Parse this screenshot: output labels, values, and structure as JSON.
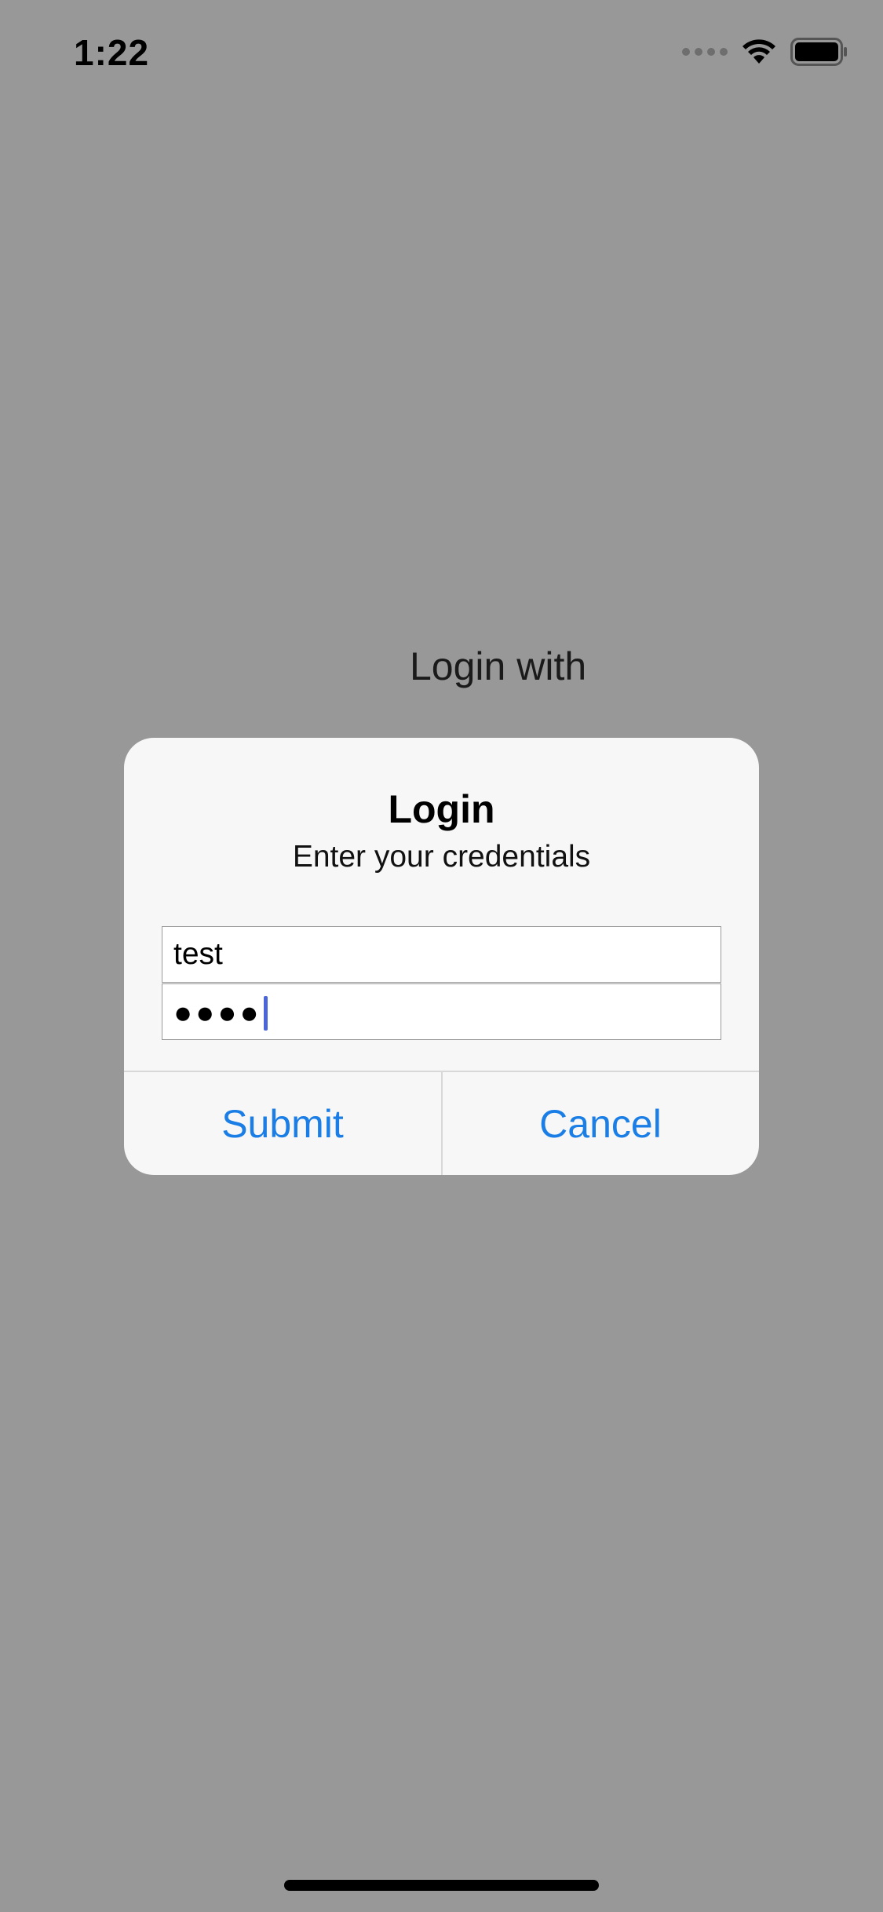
{
  "status_bar": {
    "time": "1:22",
    "icons": [
      "signal-icon",
      "wifi-icon",
      "battery-icon"
    ]
  },
  "background": {
    "label": "Login with"
  },
  "alert": {
    "title": "Login",
    "message": "Enter your credentials",
    "username_value": "test",
    "password_mask": "●●●●",
    "submit_label": "Submit",
    "cancel_label": "Cancel"
  },
  "colors": {
    "accent": "#1a7ee6",
    "dim_background": "#989898",
    "alert_background": "#f7f7f7",
    "cursor": "#4a66d8"
  }
}
